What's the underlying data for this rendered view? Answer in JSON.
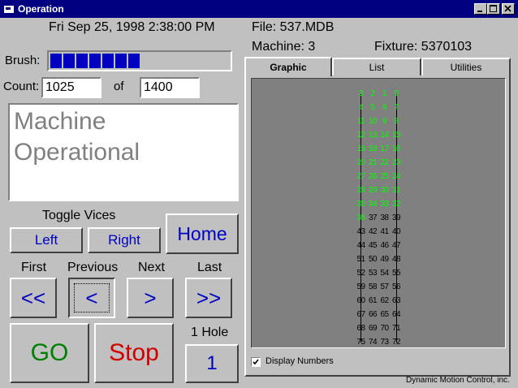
{
  "window": {
    "title": "Operation"
  },
  "header": {
    "datetime": "Fri Sep 25, 1998  2:38:00 PM",
    "file": "File: 537.MDB",
    "machine": "Machine: 3",
    "fixture": "Fixture: 5370103"
  },
  "brush": {
    "label": "Brush:",
    "level_fraction": 0.5
  },
  "count": {
    "label": "Count:",
    "value": "1025",
    "of_label": "of",
    "total": "1400"
  },
  "status": {
    "line1": "Machine",
    "line2": "Operational"
  },
  "vices": {
    "label": "Toggle Vices",
    "left": "Left",
    "right": "Right"
  },
  "home_label": "Home",
  "nav": {
    "first_label": "First",
    "previous_label": "Previous",
    "next_label": "Next",
    "last_label": "Last",
    "first": "<<",
    "previous": "<",
    "next": ">",
    "last": ">>"
  },
  "go_label": "GO",
  "stop_label": "Stop",
  "hole": {
    "label": "1 Hole",
    "value": "1"
  },
  "tabs": [
    "Graphic",
    "List",
    "Utilities"
  ],
  "display_numbers": {
    "label": "Display Numbers",
    "checked": true
  },
  "footer": "Dynamic Motion Control, inc.",
  "colors": {
    "title_bar": "#000080",
    "accent_blue": "#0000c0",
    "go_green": "#008000",
    "stop_red": "#d00000",
    "done_green": "#00ff00",
    "panel_gray": "#808080"
  },
  "graphic": {
    "rows": [
      [
        "3",
        "2",
        "1",
        "0"
      ],
      [
        "4",
        "5",
        "6",
        "7"
      ],
      [
        "11",
        "10",
        "9",
        "8"
      ],
      [
        "12",
        "13",
        "14",
        "15"
      ],
      [
        "19",
        "18",
        "17",
        "16"
      ],
      [
        "20",
        "21",
        "22",
        "23"
      ],
      [
        "27",
        "26",
        "25",
        "24"
      ],
      [
        "28",
        "29",
        "30",
        "31"
      ],
      [
        "35",
        "34",
        "33",
        "32"
      ],
      [
        "36",
        "37",
        "38",
        "39"
      ],
      [
        "43",
        "42",
        "41",
        "40"
      ],
      [
        "44",
        "45",
        "46",
        "47"
      ],
      [
        "51",
        "50",
        "49",
        "48"
      ],
      [
        "52",
        "53",
        "54",
        "55"
      ],
      [
        "59",
        "58",
        "57",
        "56"
      ],
      [
        "60",
        "61",
        "62",
        "63"
      ],
      [
        "67",
        "66",
        "65",
        "64"
      ],
      [
        "68",
        "69",
        "70",
        "71"
      ],
      [
        "75",
        "74",
        "73",
        "72"
      ]
    ],
    "completed_through": 36
  }
}
